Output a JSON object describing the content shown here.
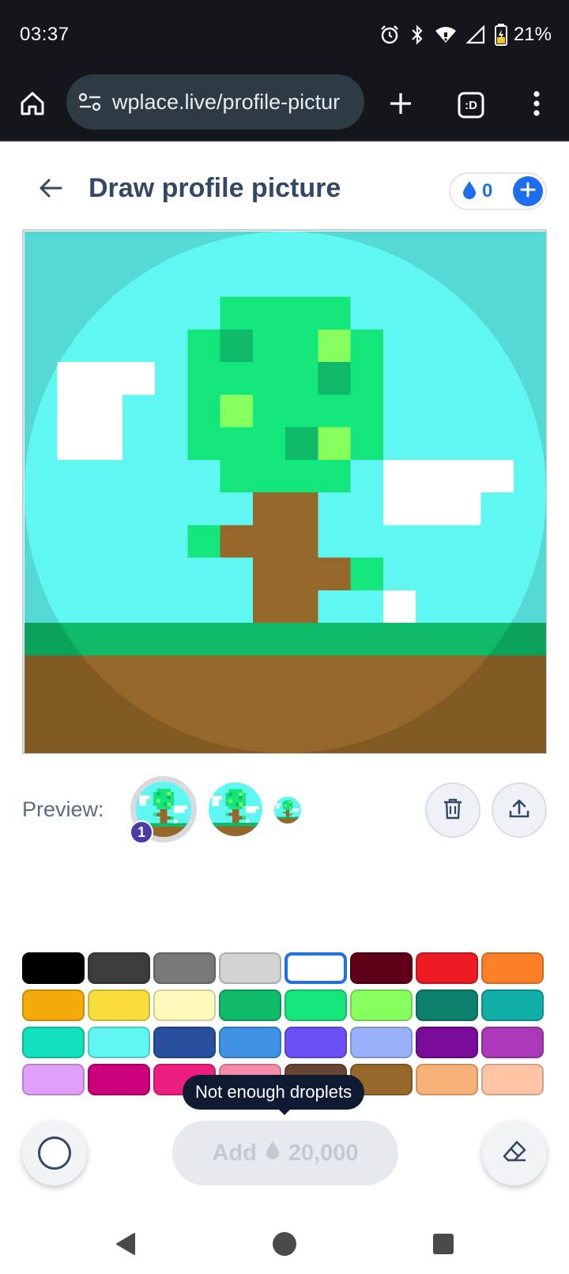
{
  "status_bar": {
    "time": "03:37",
    "battery_percent": "21%",
    "icons": [
      "alarm-icon",
      "bluetooth-icon",
      "wifi-icon",
      "cell-signal-icon",
      "battery-icon"
    ]
  },
  "browser": {
    "url": "wplace.live/profile-pictur",
    "icons": [
      "home-icon",
      "site-settings-icon",
      "new-tab-icon",
      "tab-switcher-icon",
      "more-menu-icon"
    ],
    "tab_switcher_label": ":D"
  },
  "header": {
    "title": "Draw profile picture",
    "droplets": "0"
  },
  "preview": {
    "label": "Preview:",
    "badge": "1"
  },
  "palette": {
    "colors": [
      "#000000",
      "#3c3c3c",
      "#787878",
      "#d2d2d2",
      "#ffffff",
      "#600018",
      "#ed1c24",
      "#ff7f27",
      "#f6aa09",
      "#f9dd3b",
      "#fffabc",
      "#0eb968",
      "#13e67b",
      "#87ff5e",
      "#0c816e",
      "#10aea6",
      "#13e1be",
      "#60f7f2",
      "#28509e",
      "#4093e4",
      "#6b50f6",
      "#99b1fb",
      "#780c99",
      "#aa38b9",
      "#e09ff9",
      "#cb007a",
      "#ec1f80",
      "#f38da9",
      "#684634",
      "#95682a",
      "#f8b277",
      "#ffc5a5"
    ],
    "selected_index": 4
  },
  "tooltip": {
    "text": "Not enough droplets"
  },
  "actions": {
    "add_label": "Add",
    "cost": "20,000"
  },
  "colors": {
    "accent": "#1e6ff0",
    "title": "#334766",
    "sky": "#60f7f2",
    "leaf": "#13e67b",
    "leaf_dark": "#0eb968",
    "leaf_light": "#87ff5e",
    "trunk": "#95682a",
    "cloud": "#ffffff"
  }
}
